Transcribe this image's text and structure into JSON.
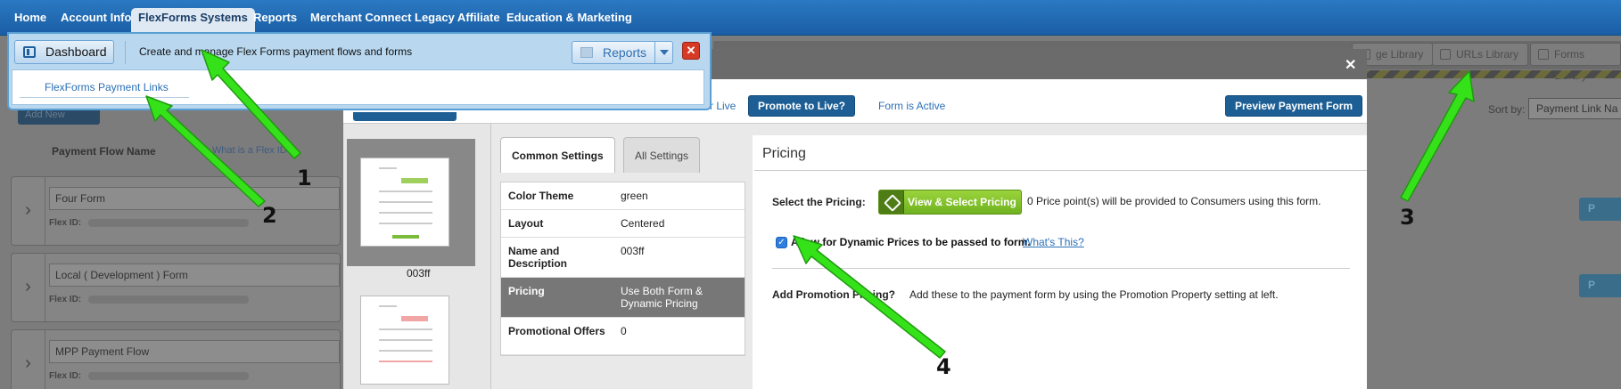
{
  "topnav": {
    "tabs": [
      {
        "label": "Home"
      },
      {
        "label": "Account Info"
      },
      {
        "label": "FlexForms Systems"
      },
      {
        "label": "Reports"
      },
      {
        "label": "Merchant Connect"
      },
      {
        "label": "Legacy Affiliate"
      },
      {
        "label": "Education & Marketing"
      }
    ],
    "active_index": 2
  },
  "background": {
    "library_buttons": [
      {
        "label": "ge Library"
      },
      {
        "label": "URLs Library"
      },
      {
        "label": "Forms Library"
      }
    ],
    "sort_label": "Sort by:",
    "sort_value": "Payment Link Na",
    "add_new": "Add New",
    "column_header": "Payment Flow Name",
    "whatis_link": "What is a Flex ID",
    "flows": [
      {
        "name": "Four Form",
        "flex_id_label": "Flex ID:"
      },
      {
        "name": "Local ( Development ) Form",
        "flex_id_label": "Flex ID:"
      },
      {
        "name": "MPP Payment Flow",
        "flex_id_label": "Flex ID:"
      }
    ],
    "right_btn_label": "P"
  },
  "dropdown": {
    "dashboard_label": "Dashboard",
    "description": "Create and manage Flex Forms payment flows and forms",
    "reports_label": "Reports",
    "close_label": "✕",
    "link": "FlexForms Payment Links"
  },
  "modal": {
    "close": "✕",
    "for_live": "for Live",
    "promote_btn": "Promote to Live?",
    "form_status": "Form is Active",
    "preview_btn": "Preview Payment Form",
    "thumb_label": "003ff",
    "tabs": [
      {
        "label": "Common Settings"
      },
      {
        "label": "All Settings"
      }
    ],
    "settings": [
      {
        "key": "Color Theme",
        "value": "green"
      },
      {
        "key": "Layout",
        "value": "Centered"
      },
      {
        "key": "Name and Description",
        "value": "003ff"
      },
      {
        "key": "Pricing",
        "value": "Use Both Form & Dynamic Pricing"
      },
      {
        "key": "Promotional Offers",
        "value": "0"
      }
    ],
    "pricing": {
      "title": "Pricing",
      "select_label": "Select the Pricing:",
      "view_select_btn": "View & Select Pricing",
      "price_note": "0 Price point(s) will be provided to Consumers using this form.",
      "dynamic_checked": true,
      "dynamic_label": "Allow for Dynamic Prices to be passed to form.",
      "whats_this": "What's This?",
      "promo_label": "Add Promotion Pricing?",
      "promo_note": "Add these to the payment form by using the Promotion Property setting at left."
    }
  },
  "annotations": {
    "color": "#35e21a",
    "numbers": [
      "1",
      "2",
      "3",
      "4"
    ]
  }
}
